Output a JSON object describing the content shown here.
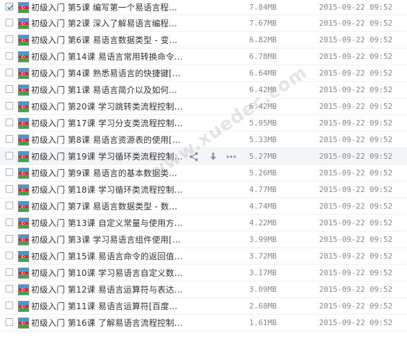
{
  "colors": {
    "row_border": "#eef0f3",
    "hover_background": "#f3f6f9",
    "text": "#333333",
    "meta_text": "#888888"
  },
  "icons": {
    "file": "azerbaijan-flag-file-icon",
    "share": "share-icon",
    "download": "download-icon",
    "more": "more-icon"
  },
  "watermark": "www.xuedec.com",
  "files": [
    {
      "name": "初级入门 第5课 编写第一个易语言程...",
      "size": "7.84MB",
      "date": "2015-09-22 09:52",
      "checked": true
    },
    {
      "name": "初级入门 第2课 深入了解易语言编程...",
      "size": "7.67MB",
      "date": "2015-09-22 09:52",
      "checked": false
    },
    {
      "name": "初级入门 第6课 易语言数据类型 - 变...",
      "size": "6.82MB",
      "date": "2015-09-22 09:52",
      "checked": false
    },
    {
      "name": "初级入门 第14课 易语言常用转换命令...",
      "size": "6.78MB",
      "date": "2015-09-22 09:52",
      "checked": false
    },
    {
      "name": "初级入门 第4课 熟悉易语言的快捷键[...",
      "size": "6.64MB",
      "date": "2015-09-22 09:52",
      "checked": false
    },
    {
      "name": "初级入门 第1课 易语言简介以及如何...",
      "size": "6.42MB",
      "date": "2015-09-22 09:52",
      "checked": false
    },
    {
      "name": "初级入门 第20课 学习跳转类流程控制...",
      "size": "6.42MB",
      "date": "2015-09-22 09:52",
      "checked": false
    },
    {
      "name": "初级入门 第17课 学习分支类流程控制...",
      "size": "5.95MB",
      "date": "2015-09-22 09:52",
      "checked": false
    },
    {
      "name": "初级入门 第8课 易语言资源表的使用[...",
      "size": "5.33MB",
      "date": "2015-09-22 09:52",
      "checked": false
    },
    {
      "name": "初级入门 第19课 学习循环类流程控制...",
      "size": "5.27MB",
      "date": "2015-09-22 09:52",
      "checked": false,
      "hovered": true
    },
    {
      "name": "初级入门 第9课 易语言的基本数据类...",
      "size": "5.26MB",
      "date": "2015-09-22 09:52",
      "checked": false
    },
    {
      "name": "初级入门 第18课 学习循环类流程控制...",
      "size": "4.77MB",
      "date": "2015-09-22 09:52",
      "checked": false
    },
    {
      "name": "初级入门 第7课 易语言数据类型 - 数...",
      "size": "4.74MB",
      "date": "2015-09-22 09:52",
      "checked": false
    },
    {
      "name": "初级入门 第13课 自定义常量与使用方...",
      "size": "4.22MB",
      "date": "2015-09-22 09:52",
      "checked": false
    },
    {
      "name": "初级入门 第3课 学习易语言组件使用[...",
      "size": "3.99MB",
      "date": "2015-09-22 09:52",
      "checked": false
    },
    {
      "name": "初级入门 第15课 易语言命令的返回值...",
      "size": "3.72MB",
      "date": "2015-09-22 09:52",
      "checked": false
    },
    {
      "name": "初级入门 第10课 学习易语言自定义数...",
      "size": "3.17MB",
      "date": "2015-09-22 09:52",
      "checked": false
    },
    {
      "name": "初级入门 第12课 易语言运算符与表达...",
      "size": "3.09MB",
      "date": "2015-09-22 09:52",
      "checked": false
    },
    {
      "name": "初级入门 第11课 易语言运算符[百度...",
      "size": "2.68MB",
      "date": "2015-09-22 09:52",
      "checked": false
    },
    {
      "name": "初级入门 第16课 了解易语言流程控制...",
      "size": "1.61MB",
      "date": "2015-09-22 09:52",
      "checked": false
    }
  ]
}
